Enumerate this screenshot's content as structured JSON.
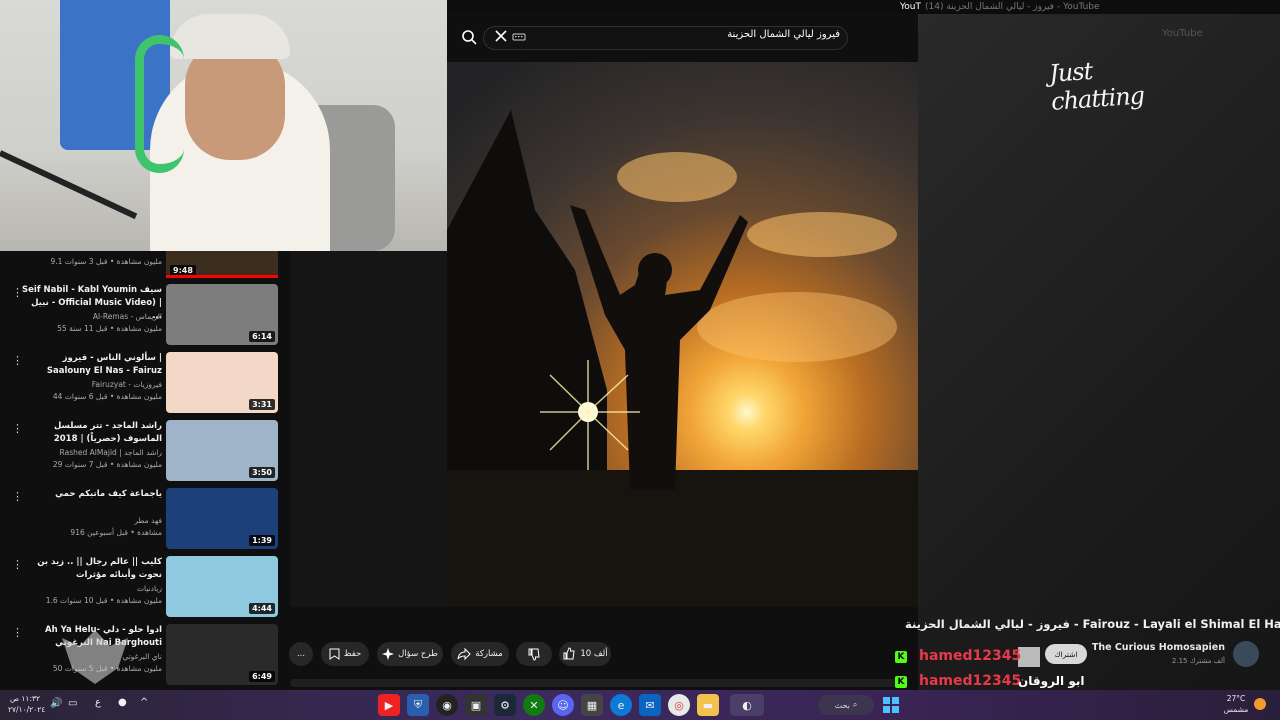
{
  "top_strip": {
    "title": "YouT",
    "blurred": "فيروز - ليالي الشمال الحزينة (14) - YouTube"
  },
  "search": {
    "query": "فيروز ليالي الشمال الحزينة"
  },
  "overlay": {
    "just_chatting": "Just chatting",
    "yt_logo": "YouTube"
  },
  "video": {
    "title": "فيروز - ليالي الشمال الحزينة - Fairouz - Layali el Shimal El Hazeeni",
    "channel": "The Curious Homosapien",
    "subscribers": "2.15 ألف مشترك",
    "subscribe_label": "اشتراك"
  },
  "actions": {
    "likes": "10 ألف",
    "share": "مشاركة",
    "ask": "طرح سؤال",
    "save": "حفظ",
    "more": "..."
  },
  "top_item": {
    "meta": "9.1 مليون مشاهدة • قبل 3 سنوات",
    "duration": "9:48"
  },
  "recommended": [
    {
      "title": "Seif Nabil - Kabl Youmin سيف نبيل - Official Music Video) | ...",
      "channel": "Al-Remas - الريماس",
      "meta": "55 مليون مشاهدة • قبل 11 سنة",
      "duration": "6:14",
      "thumb": "#7d7d7d"
    },
    {
      "title": "سألوني الناس - فيروز | Saalouny El Nas - Fairuz",
      "channel": "Fairuzyat - فيروزيات",
      "meta": "44 مليون مشاهدة • قبل 6 سنوات",
      "duration": "3:31",
      "thumb": "#f3d8c8"
    },
    {
      "title": "راشد الماجد - تتر مسلسل الماسوف (حصرياً) | 2018",
      "channel": "Rashed AlMajid | راشد الماجد",
      "meta": "29 مليون مشاهدة • قبل 7 سنوات",
      "duration": "3:50",
      "thumb": "#9fb4c9"
    },
    {
      "title": "ياجماعة كيف ماتبكم حمي",
      "channel": "فهد مطر",
      "meta": "916 مشاهدة • قبل أسبوعين",
      "duration": "1:39",
      "thumb": "#1d3f7a"
    },
    {
      "title": "كليب || عالم رجال || .. زيد بن نحوت وأبنائه مؤثرات",
      "channel": "زيادنيات",
      "meta": "1.6 مليون مشاهدة • قبل 10 سنوات",
      "duration": "4:44",
      "thumb": "#8ec9e0"
    },
    {
      "title": "Ah Ya Helu- ادوا حلو - دلي البرغوتي Nai Barghouti",
      "channel": "ناي البرغوتي",
      "meta": "50 مليون مشاهدة • قبل 5 سنوات",
      "duration": "6:49",
      "thumb": "#2a2a2a"
    }
  ],
  "chat": [
    {
      "badge": "K",
      "user": "hamed12345",
      "message": ""
    },
    {
      "badge": "K",
      "user": "hamed12345",
      "message": "ابو الروقان"
    }
  ],
  "taskbar": {
    "clock_time": "١١:٣٢ ص",
    "clock_date": "٢٧/١٠/٢٠٢٤",
    "lang": "ع",
    "search_label": "بحث",
    "weather_temp": "27°C",
    "weather_desc": "مشمس"
  },
  "colors": {
    "accent": "#ff0000",
    "kick": "#53fc18",
    "chat_user": "#e8394a"
  }
}
